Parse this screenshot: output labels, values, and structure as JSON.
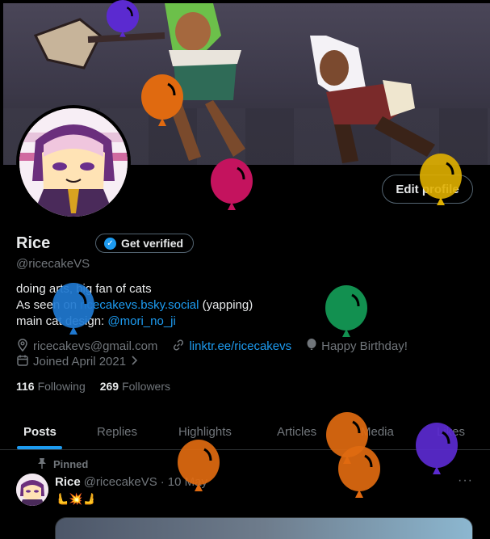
{
  "profile": {
    "name": "Rice",
    "handle": "@ricecakeVS",
    "edit_label": "Edit profile",
    "verify_label": "Get verified",
    "bio_line1": "doing arts, big fan of cats",
    "bio_line2_prefix": "As seen on ",
    "bio_line2_link": "ricecakevs.bsky.social",
    "bio_line2_suffix": " (yapping)",
    "bio_line3_prefix": "main cat design: ",
    "bio_line3_link": "@mori_no_ji",
    "email": "ricecakevs@gmail.com",
    "website": "linktr.ee/ricecakevs",
    "birthday": "Happy Birthday!",
    "joined": "Joined April 2021",
    "following_count": "116",
    "following_label": "Following",
    "followers_count": "269",
    "followers_label": "Followers"
  },
  "tabs": [
    "Posts",
    "Replies",
    "Highlights",
    "Articles",
    "Media",
    "Likes"
  ],
  "post": {
    "pinned_label": "Pinned",
    "name": "Rice",
    "handle": "@ricecakeVS",
    "separator": "·",
    "date": "10 May",
    "emoji": "🫷💥🫸",
    "more": "···"
  },
  "colors": {
    "accent": "#1d9bf0",
    "balloons": [
      "#5b2ad0",
      "#e06a10",
      "#c4135e",
      "#e0b000",
      "#1f78d0",
      "#129050",
      "#e06a10",
      "#e06a10",
      "#e06a10",
      "#5b2ad0"
    ]
  }
}
